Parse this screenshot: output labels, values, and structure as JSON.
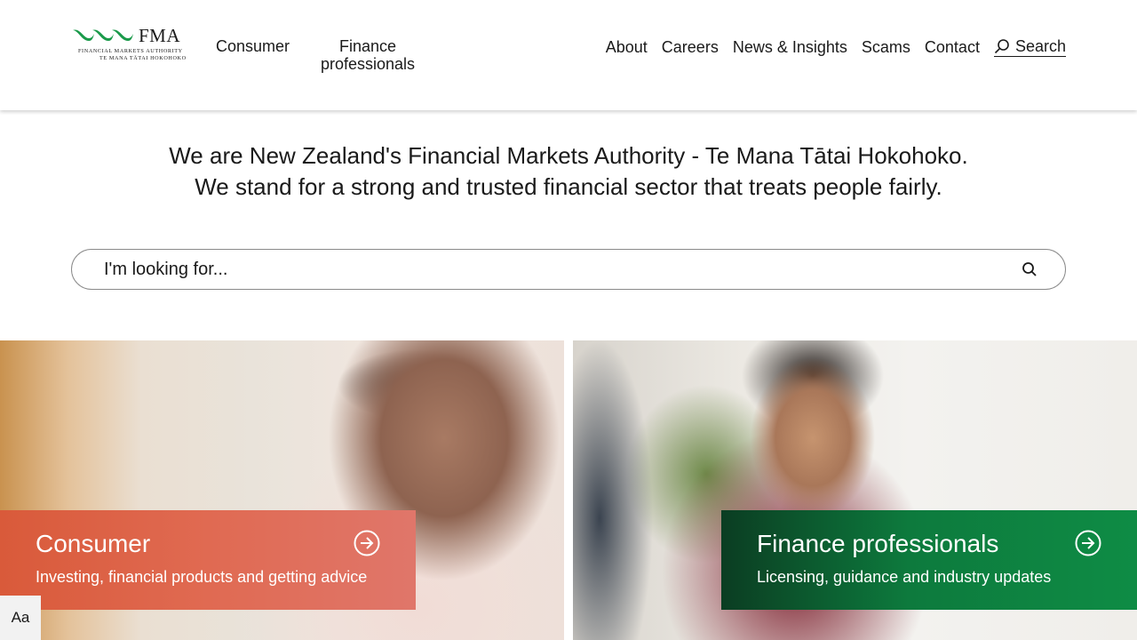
{
  "logo": {
    "text": "FMA",
    "sub1": "FINANCIAL MARKETS AUTHORITY",
    "sub2": "TE MANA TĀTAI HOKOHOKO",
    "brand_color": "#1a9a4a"
  },
  "nav": {
    "consumer": "Consumer",
    "finance": "Finance professionals",
    "about": "About",
    "careers": "Careers",
    "news": "News & Insights",
    "scams": "Scams",
    "contact": "Contact",
    "search": "Search"
  },
  "intro": {
    "line1": "We are New Zealand's Financial Markets Authority - Te Mana Tātai Hokohoko.",
    "line2": "We stand for a strong and trusted financial sector that treats people fairly."
  },
  "search": {
    "placeholder": "I'm looking for..."
  },
  "cards": {
    "consumer": {
      "title": "Consumer",
      "subtitle": "Investing, financial products and getting advice",
      "color": "#d95a3a"
    },
    "finance": {
      "title": "Finance professionals",
      "subtitle": "Licensing, guidance and industry updates",
      "color": "#0e8c45"
    }
  },
  "accessibility": {
    "font_button": "Aa"
  }
}
